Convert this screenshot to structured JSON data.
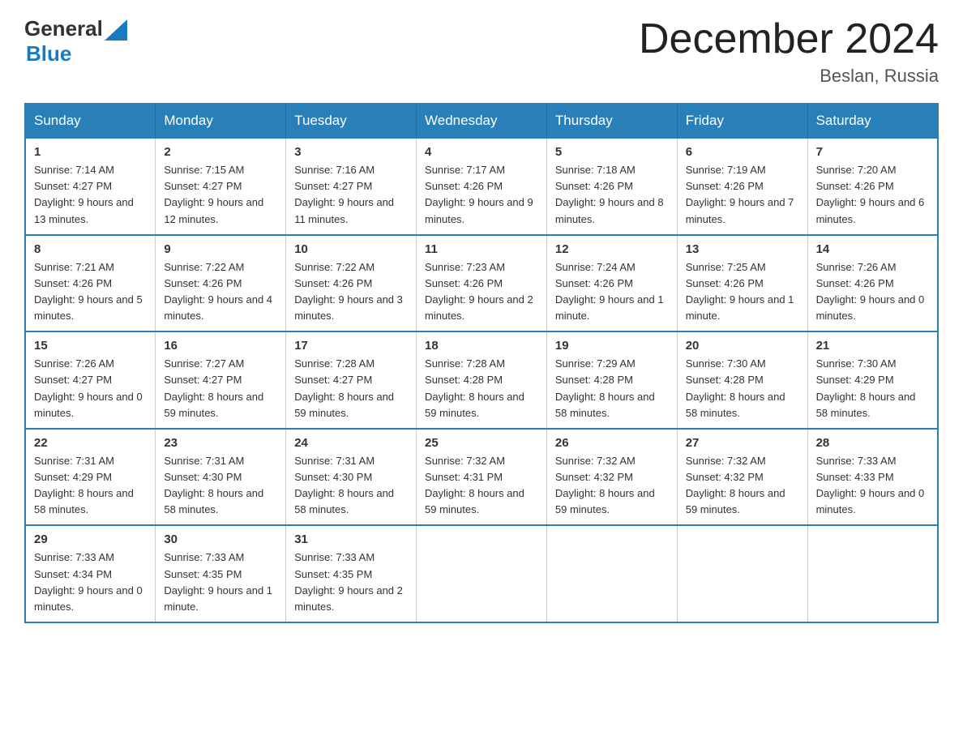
{
  "header": {
    "logo_general": "General",
    "logo_blue": "Blue",
    "title": "December 2024",
    "subtitle": "Beslan, Russia"
  },
  "days_of_week": [
    "Sunday",
    "Monday",
    "Tuesday",
    "Wednesday",
    "Thursday",
    "Friday",
    "Saturday"
  ],
  "weeks": [
    [
      {
        "day": "1",
        "sunrise": "7:14 AM",
        "sunset": "4:27 PM",
        "daylight": "9 hours and 13 minutes."
      },
      {
        "day": "2",
        "sunrise": "7:15 AM",
        "sunset": "4:27 PM",
        "daylight": "9 hours and 12 minutes."
      },
      {
        "day": "3",
        "sunrise": "7:16 AM",
        "sunset": "4:27 PM",
        "daylight": "9 hours and 11 minutes."
      },
      {
        "day": "4",
        "sunrise": "7:17 AM",
        "sunset": "4:26 PM",
        "daylight": "9 hours and 9 minutes."
      },
      {
        "day": "5",
        "sunrise": "7:18 AM",
        "sunset": "4:26 PM",
        "daylight": "9 hours and 8 minutes."
      },
      {
        "day": "6",
        "sunrise": "7:19 AM",
        "sunset": "4:26 PM",
        "daylight": "9 hours and 7 minutes."
      },
      {
        "day": "7",
        "sunrise": "7:20 AM",
        "sunset": "4:26 PM",
        "daylight": "9 hours and 6 minutes."
      }
    ],
    [
      {
        "day": "8",
        "sunrise": "7:21 AM",
        "sunset": "4:26 PM",
        "daylight": "9 hours and 5 minutes."
      },
      {
        "day": "9",
        "sunrise": "7:22 AM",
        "sunset": "4:26 PM",
        "daylight": "9 hours and 4 minutes."
      },
      {
        "day": "10",
        "sunrise": "7:22 AM",
        "sunset": "4:26 PM",
        "daylight": "9 hours and 3 minutes."
      },
      {
        "day": "11",
        "sunrise": "7:23 AM",
        "sunset": "4:26 PM",
        "daylight": "9 hours and 2 minutes."
      },
      {
        "day": "12",
        "sunrise": "7:24 AM",
        "sunset": "4:26 PM",
        "daylight": "9 hours and 1 minute."
      },
      {
        "day": "13",
        "sunrise": "7:25 AM",
        "sunset": "4:26 PM",
        "daylight": "9 hours and 1 minute."
      },
      {
        "day": "14",
        "sunrise": "7:26 AM",
        "sunset": "4:26 PM",
        "daylight": "9 hours and 0 minutes."
      }
    ],
    [
      {
        "day": "15",
        "sunrise": "7:26 AM",
        "sunset": "4:27 PM",
        "daylight": "9 hours and 0 minutes."
      },
      {
        "day": "16",
        "sunrise": "7:27 AM",
        "sunset": "4:27 PM",
        "daylight": "8 hours and 59 minutes."
      },
      {
        "day": "17",
        "sunrise": "7:28 AM",
        "sunset": "4:27 PM",
        "daylight": "8 hours and 59 minutes."
      },
      {
        "day": "18",
        "sunrise": "7:28 AM",
        "sunset": "4:28 PM",
        "daylight": "8 hours and 59 minutes."
      },
      {
        "day": "19",
        "sunrise": "7:29 AM",
        "sunset": "4:28 PM",
        "daylight": "8 hours and 58 minutes."
      },
      {
        "day": "20",
        "sunrise": "7:30 AM",
        "sunset": "4:28 PM",
        "daylight": "8 hours and 58 minutes."
      },
      {
        "day": "21",
        "sunrise": "7:30 AM",
        "sunset": "4:29 PM",
        "daylight": "8 hours and 58 minutes."
      }
    ],
    [
      {
        "day": "22",
        "sunrise": "7:31 AM",
        "sunset": "4:29 PM",
        "daylight": "8 hours and 58 minutes."
      },
      {
        "day": "23",
        "sunrise": "7:31 AM",
        "sunset": "4:30 PM",
        "daylight": "8 hours and 58 minutes."
      },
      {
        "day": "24",
        "sunrise": "7:31 AM",
        "sunset": "4:30 PM",
        "daylight": "8 hours and 58 minutes."
      },
      {
        "day": "25",
        "sunrise": "7:32 AM",
        "sunset": "4:31 PM",
        "daylight": "8 hours and 59 minutes."
      },
      {
        "day": "26",
        "sunrise": "7:32 AM",
        "sunset": "4:32 PM",
        "daylight": "8 hours and 59 minutes."
      },
      {
        "day": "27",
        "sunrise": "7:32 AM",
        "sunset": "4:32 PM",
        "daylight": "8 hours and 59 minutes."
      },
      {
        "day": "28",
        "sunrise": "7:33 AM",
        "sunset": "4:33 PM",
        "daylight": "9 hours and 0 minutes."
      }
    ],
    [
      {
        "day": "29",
        "sunrise": "7:33 AM",
        "sunset": "4:34 PM",
        "daylight": "9 hours and 0 minutes."
      },
      {
        "day": "30",
        "sunrise": "7:33 AM",
        "sunset": "4:35 PM",
        "daylight": "9 hours and 1 minute."
      },
      {
        "day": "31",
        "sunrise": "7:33 AM",
        "sunset": "4:35 PM",
        "daylight": "9 hours and 2 minutes."
      },
      null,
      null,
      null,
      null
    ]
  ],
  "labels": {
    "sunrise": "Sunrise:",
    "sunset": "Sunset:",
    "daylight": "Daylight:"
  }
}
